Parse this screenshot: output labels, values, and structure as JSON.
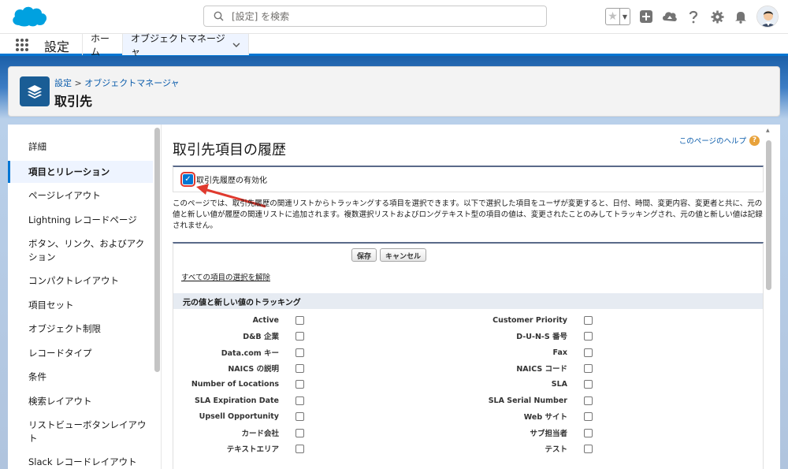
{
  "header": {
    "search_placeholder": "[設定] を検索"
  },
  "nav": {
    "app_name": "設定",
    "tabs": [
      {
        "label": "ホーム"
      },
      {
        "label": "オブジェクトマネージャ"
      }
    ]
  },
  "page_header": {
    "breadcrumb_root": "設定",
    "breadcrumb_sep": " > ",
    "breadcrumb_current": "オブジェクトマネージャ",
    "title": "取引先"
  },
  "sidebar": {
    "items": [
      {
        "label": "詳細"
      },
      {
        "label": "項目とリレーション"
      },
      {
        "label": "ページレイアウト"
      },
      {
        "label": "Lightning レコードページ"
      },
      {
        "label": "ボタン、リンク、およびアクション"
      },
      {
        "label": "コンパクトレイアウト"
      },
      {
        "label": "項目セット"
      },
      {
        "label": "オブジェクト制限"
      },
      {
        "label": "レコードタイプ"
      },
      {
        "label": "条件"
      },
      {
        "label": "検索レイアウト"
      },
      {
        "label": "リストビューボタンレイアウト"
      },
      {
        "label": "Slack レコードレイアウト"
      }
    ]
  },
  "main": {
    "title": "取引先項目の履歴",
    "help_link": "このページのヘルプ",
    "enable_label": "取引先履歴の有効化",
    "description": "このページでは、取引先履歴の関連リストからトラッキングする項目を選択できます。以下で選択した項目をユーザが変更すると、日付、時間、変更内容、変更者と共に、元の値と新しい値が履歴の関連リストに追加されます。複数選択リストおよびロングテキスト型の項目の値は、変更されたことのみしてトラッキングされ、元の値と新しい値は記録されません。",
    "save_label": "保存",
    "cancel_label": "キャンセル",
    "deselect_all": "すべての項目の選択を解除",
    "section_title": "元の値と新しい値のトラッキング",
    "fields_left": [
      "Active",
      "D&B 企業",
      "Data.com キー",
      "NAICS の説明",
      "Number of Locations",
      "SLA Expiration Date",
      "Upsell Opportunity",
      "カード会社",
      "テキストエリア"
    ],
    "fields_right": [
      "Customer Priority",
      "D-U-N-S 番号",
      "Fax",
      "NAICS コード",
      "SLA",
      "SLA Serial Number",
      "Web サイト",
      "サブ担当者",
      "テスト"
    ]
  },
  "colors": {
    "brand_blue": "#0176d3",
    "header_band": "#1b5fa8",
    "annotation_red": "#e03a2f"
  }
}
